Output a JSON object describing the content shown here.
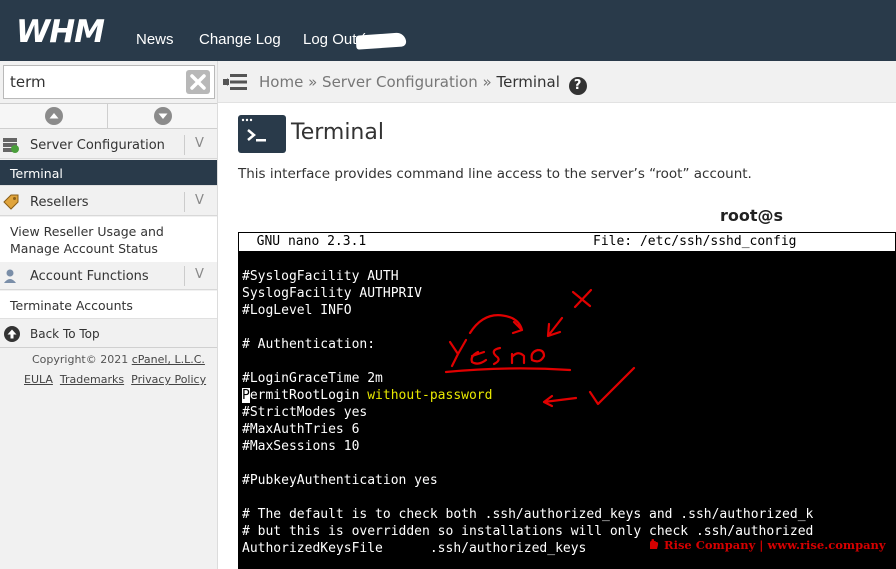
{
  "header": {
    "logo_text": "WHM",
    "nav": [
      "News",
      "Change Log",
      "Log Out ("
    ]
  },
  "sidebar": {
    "search": {
      "value": "term",
      "placeholder": ""
    },
    "categories": [
      {
        "label": "Server Configuration",
        "chevron": "V",
        "icon": "server-config-icon"
      },
      {
        "label": "Resellers",
        "chevron": "V",
        "icon": "resellers-tag-icon"
      },
      {
        "label": "Account Functions",
        "chevron": "V",
        "icon": "account-user-icon"
      }
    ],
    "items": {
      "terminal": "Terminal",
      "view_reseller": "View Reseller Usage and Manage Account Status",
      "terminate": "Terminate Accounts"
    },
    "back_to_top": "Back To Top",
    "footer": {
      "copyright_prefix": "Copyright© 2021 ",
      "copyright_link": "cPanel, L.L.C.",
      "links": [
        "EULA",
        "Trademarks",
        "Privacy Policy"
      ]
    }
  },
  "breadcrumb": {
    "items": [
      "Home",
      "Server Configuration",
      "Terminal"
    ],
    "separator": "»",
    "help": "?"
  },
  "page": {
    "title": "Terminal",
    "description": "This interface provides command line access to the server’s “root” account.",
    "prompt_user": "root@s"
  },
  "terminal": {
    "header_left": "  GNU nano 2.3.1",
    "header_right": "File: /etc/ssh/sshd_config",
    "lines": [
      "#SyslogFacility AUTH",
      "SyslogFacility AUTHPRIV",
      "#LogLevel INFO",
      "",
      "# Authentication:",
      "",
      "#LoginGraceTime 2m",
      "PermitRootLogin without-password",
      "#StrictModes yes",
      "#MaxAuthTries 6",
      "#MaxSessions 10",
      "",
      "#PubkeyAuthentication yes",
      "",
      "# The default is to check both .ssh/authorized_keys and .ssh/authorized_k",
      "# but this is overridden so installations will only check .ssh/authorized",
      "AuthorizedKeysFile      .ssh/authorized_keys"
    ],
    "permit_key": "ermitRootLogin ",
    "permit_cursor": "P",
    "permit_value": "without-password"
  },
  "annotation": {
    "handwritten": "yes no",
    "mark": "X",
    "color": "#e00000"
  },
  "watermark": "Rise Company | www.rise.company",
  "colors": {
    "topbar": "#293a4a",
    "sidebar_active": "#293a4a",
    "terminal_bg": "#000000",
    "highlight": "#e8e800"
  }
}
